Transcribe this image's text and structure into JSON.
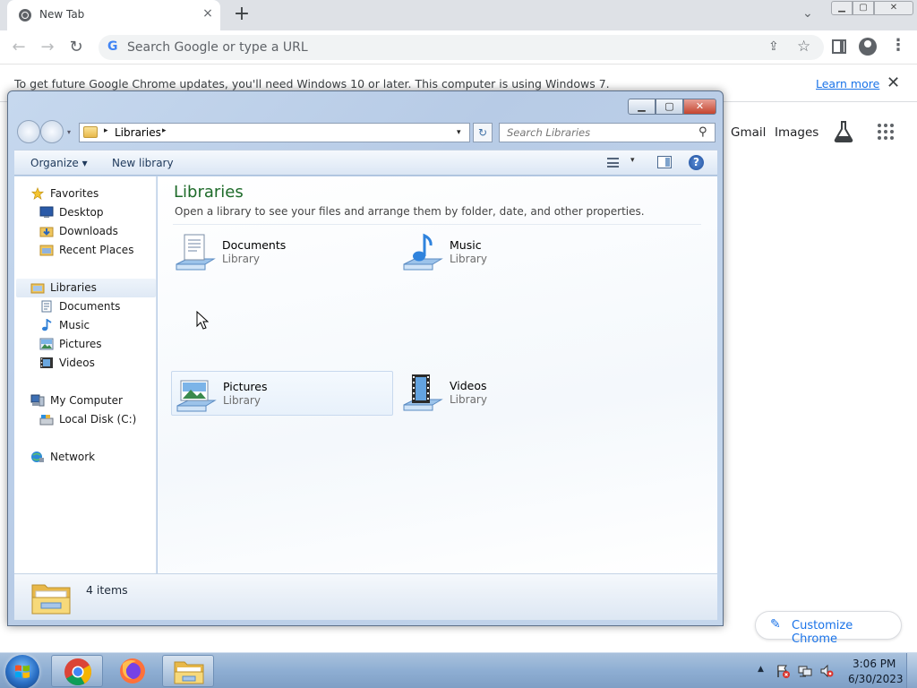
{
  "chrome": {
    "tab_title": "New Tab",
    "tab_close": "×",
    "new_tab": "+",
    "tab_search": "⌄",
    "omnibox_placeholder": "Search Google or type a URL",
    "omnibox_g": "G",
    "infobar_text": "To get future Google Chrome updates, you'll need Windows 10 or later. This computer is using Windows 7.",
    "infobar_link": "Learn more",
    "infobar_close": "✕",
    "menu_dots": "⋮",
    "links": {
      "gmail": "Gmail",
      "images": "Images"
    },
    "customize_label": "Customize Chrome",
    "icons": {
      "back": "←",
      "forward": "→",
      "reload": "↻",
      "share": "⇪",
      "star": "☆",
      "pencil": "✎"
    }
  },
  "explorer": {
    "address": {
      "location": "Libraries",
      "sep": "▸",
      "dropdown": "▾"
    },
    "refresh": "↻",
    "search_placeholder": "Search Libraries",
    "search_icon": "⚲",
    "commands": {
      "organize": "Organize ▾",
      "new_library": "New library",
      "view_dropdown": "▾",
      "help": "?"
    },
    "window_controls": {
      "minimize": "▁",
      "maximize": "▢",
      "close": "✕"
    },
    "recent_dropdown": "▾",
    "nav": {
      "favorites": "Favorites",
      "desktop": "Desktop",
      "downloads": "Downloads",
      "recent_places": "Recent Places",
      "libraries": "Libraries",
      "documents": "Documents",
      "music": "Music",
      "pictures": "Pictures",
      "videos": "Videos",
      "my_computer": "My Computer",
      "local_disk": "Local Disk (C:)",
      "network": "Network"
    },
    "content": {
      "heading": "Libraries",
      "subtitle": "Open a library to see your files and arrange them by folder, date, and other properties.",
      "tiles": [
        {
          "name": "Documents",
          "type": "Library"
        },
        {
          "name": "Music",
          "type": "Library"
        },
        {
          "name": "Pictures",
          "type": "Library"
        },
        {
          "name": "Videos",
          "type": "Library"
        }
      ]
    },
    "status": {
      "count": "4 items"
    }
  },
  "taskbar": {
    "tray_chevron": "▲",
    "time": "3:06 PM",
    "date": "6/30/2023"
  },
  "colors": {
    "accent_link": "#1a73e8",
    "library_heading": "#1e6b2a",
    "taskbar": "#8eaed3"
  }
}
